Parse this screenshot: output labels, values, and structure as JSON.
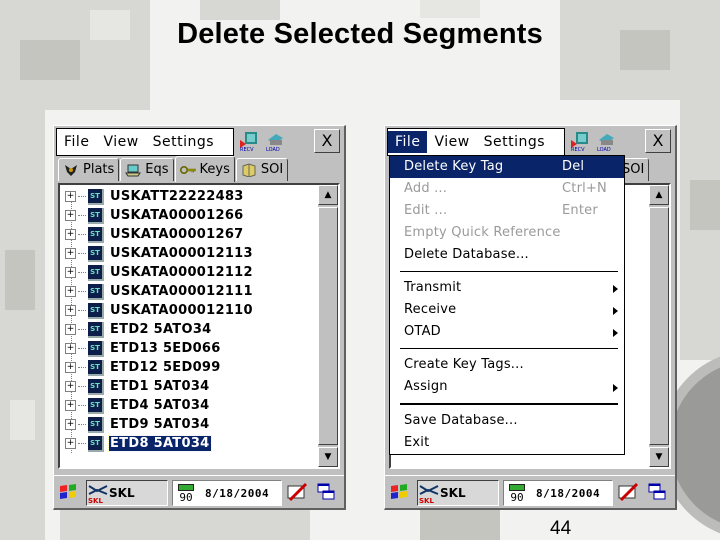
{
  "slide": {
    "title": "Delete Selected Segments",
    "page_number": "44"
  },
  "left_window": {
    "menu": [
      "File",
      "View",
      "Settings"
    ],
    "toolbar_icons": [
      "recv-icon",
      "load-icon"
    ],
    "toolbar_icon_labels": [
      "RECV",
      "LOAD"
    ],
    "close_label": "X",
    "tabs": [
      {
        "label": "Plats",
        "icon": "plats-icon"
      },
      {
        "label": "Eqs",
        "icon": "eqs-icon"
      },
      {
        "label": "Keys",
        "icon": "key-icon",
        "selected": true
      },
      {
        "label": "SOI",
        "icon": "soi-icon"
      }
    ],
    "tree_items": [
      "USKATT22222483",
      "USKATA00001266",
      "USKATA00001267",
      "USKATA000012113",
      "USKATA000012112",
      "USKATA000012111",
      "USKATA000012110",
      "ETD2 5ATO34",
      "ETD13 5ED066",
      "ETD12 5ED099",
      "ETD1 5AT034",
      "ETD4 5AT034",
      "ETD9 5AT034",
      "ETD8 5AT034"
    ],
    "selected_item": "ETD8 5AT034",
    "item_icon_label": "ST"
  },
  "right_window": {
    "menu": [
      "File",
      "View",
      "Settings"
    ],
    "active_menu": "File",
    "close_label": "X",
    "visible_tab": "SOI",
    "file_menu": [
      {
        "label": "Delete Key Tag",
        "shortcut": "Del",
        "state": "highlighted"
      },
      {
        "label": "Add ...",
        "shortcut": "Ctrl+N",
        "state": "disabled"
      },
      {
        "label": "Edit ...",
        "shortcut": "Enter",
        "state": "disabled"
      },
      {
        "label": "Empty Quick Reference",
        "shortcut": "",
        "state": "disabled"
      },
      {
        "label": "Delete Database...",
        "shortcut": "",
        "state": "enabled"
      },
      {
        "separator": true
      },
      {
        "label": "Transmit",
        "submenu": true,
        "state": "enabled"
      },
      {
        "label": "Receive",
        "submenu": true,
        "state": "enabled"
      },
      {
        "label": "OTAD",
        "submenu": true,
        "state": "enabled"
      },
      {
        "separator": true
      },
      {
        "label": "Create Key Tags...",
        "state": "enabled"
      },
      {
        "label": "Assign",
        "submenu": true,
        "state": "enabled"
      },
      {
        "separator": true,
        "thick": true
      },
      {
        "label": "Save Database...",
        "state": "enabled"
      },
      {
        "label": "Exit",
        "state": "enabled"
      }
    ]
  },
  "taskbar": {
    "app_label": "SKL",
    "app_sub_label": "SKL",
    "battery_level": "90",
    "date": "8/18/2004"
  },
  "colors": {
    "selection": "#0a246a",
    "window_face": "#c0c0c0",
    "disabled_text": "#9a9a9a"
  }
}
